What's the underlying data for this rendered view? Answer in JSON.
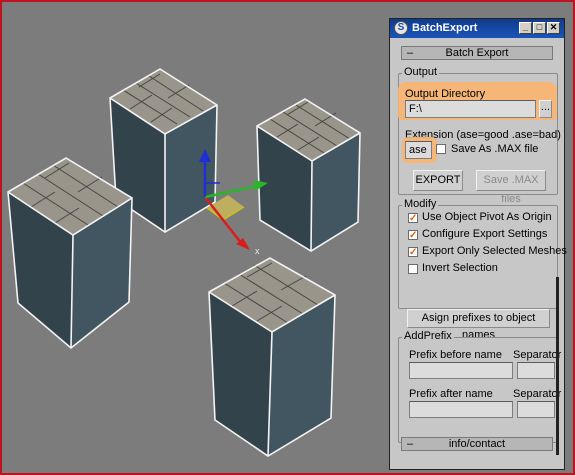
{
  "window": {
    "title": "BatchExport"
  },
  "rollouts": {
    "batch_export": "Batch Export",
    "info": "info/contact",
    "minus": "–"
  },
  "output": {
    "group_label": "Output",
    "dir_label": "Output Directory",
    "dir_value": "F:\\",
    "browse_label": "...",
    "ext_label": "Extension (ase=good .ase=bad)",
    "ext_value": "ase",
    "save_max_label": "Save As .MAX file",
    "save_max_checked": false,
    "export_button": "EXPORT",
    "save_max_button": "Save .MAX files"
  },
  "modify": {
    "group_label": "Modify",
    "options": [
      {
        "label": "Use Object Pivot As Origin",
        "checked": true
      },
      {
        "label": "Configure Export Settings",
        "checked": true
      },
      {
        "label": "Export Only Selected Meshes",
        "checked": true
      },
      {
        "label": "Invert Selection",
        "checked": false
      }
    ],
    "assign_button": "Asign prefixes to object names"
  },
  "addprefix": {
    "group_label": "AddPrefix",
    "prefix_before": "Prefix before name",
    "prefix_after": "Prefix after name",
    "separator": "Separator"
  },
  "gizmo": {
    "x_label": "x"
  },
  "colors": {
    "highlight": "#f9b46f",
    "check": "#e0620a",
    "titlebar": "#1b55b9",
    "viewport_border": "#c0121f"
  }
}
